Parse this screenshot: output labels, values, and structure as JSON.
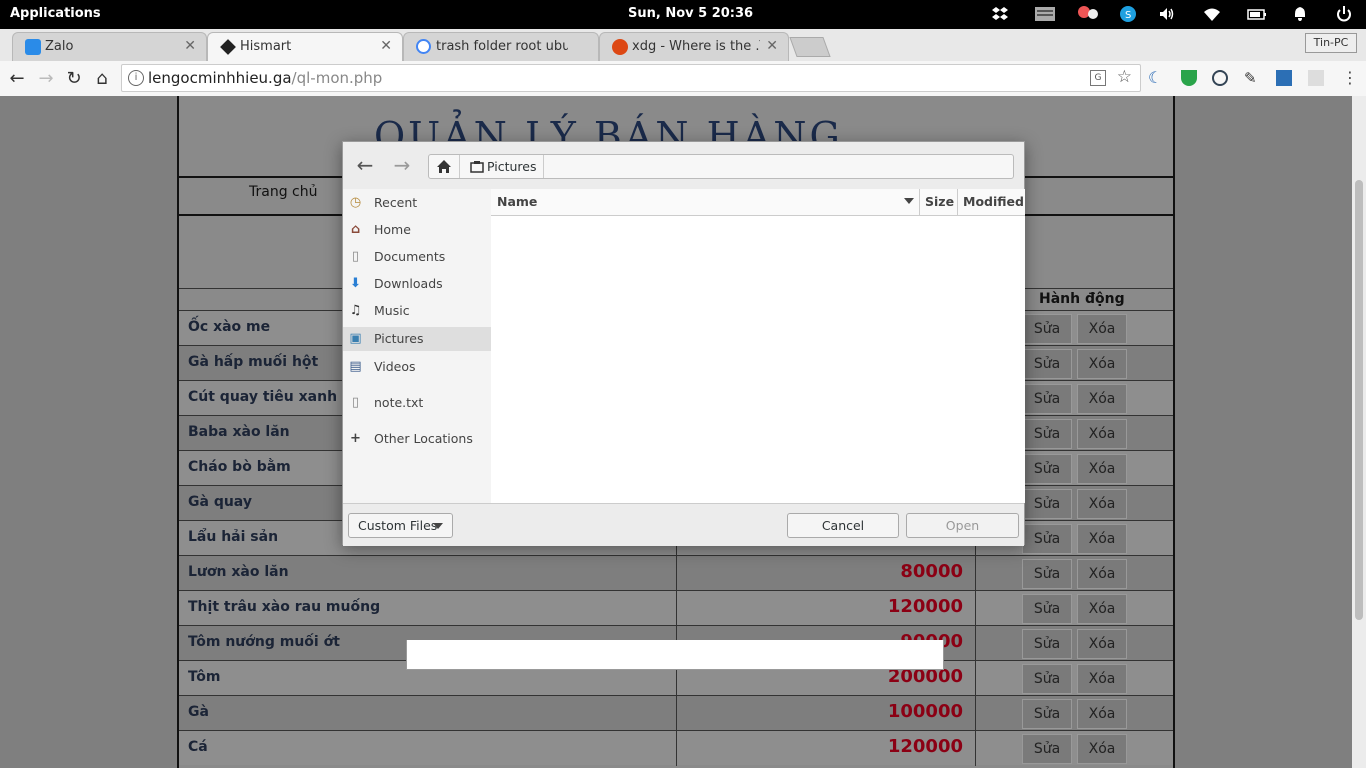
{
  "topbar": {
    "applications": "Applications",
    "clock": "Sun, Nov  5   20:36"
  },
  "tabs": [
    {
      "title": "Zalo",
      "active": false
    },
    {
      "title": "Hismart",
      "active": true
    },
    {
      "title": "trash folder root ubuntu",
      "active": false
    },
    {
      "title": "xdg - Where is the .Tras",
      "active": false
    }
  ],
  "profile": "Tin-PC",
  "address": {
    "host": "lengocminhhieu.ga",
    "path": "/ql-mon.php"
  },
  "site": {
    "banner_title": "QUẢN LÝ BÁN HÀNG",
    "menu_home": "Trang chủ",
    "actions_header": "Hành động",
    "edit_label": "Sửa",
    "delete_label": "Xóa",
    "rows": [
      {
        "name": "Ốc xào me",
        "price": ""
      },
      {
        "name": "Gà hấp muối hột",
        "price": ""
      },
      {
        "name": "Cút quay tiêu xanh",
        "price": ""
      },
      {
        "name": "Baba xào lăn",
        "price": ""
      },
      {
        "name": "Cháo bò bằm",
        "price": ""
      },
      {
        "name": "Gà quay",
        "price": ""
      },
      {
        "name": "Lẩu hải sản",
        "price": ""
      },
      {
        "name": "Lươn xào lăn",
        "price": "80000"
      },
      {
        "name": "Thịt trâu xào rau muống",
        "price": "120000"
      },
      {
        "name": "Tôm nướng muối ớt",
        "price": "90000"
      },
      {
        "name": "Tôm",
        "price": "200000"
      },
      {
        "name": "Gà",
        "price": "100000"
      },
      {
        "name": "Cá",
        "price": "120000"
      }
    ]
  },
  "dialog": {
    "current_folder": "Pictures",
    "places": [
      {
        "label": "Recent",
        "icon": "clock-icon"
      },
      {
        "label": "Home",
        "icon": "home-icon"
      },
      {
        "label": "Documents",
        "icon": "document-icon"
      },
      {
        "label": "Downloads",
        "icon": "download-icon"
      },
      {
        "label": "Music",
        "icon": "music-icon"
      },
      {
        "label": "Pictures",
        "icon": "pictures-icon",
        "selected": true
      },
      {
        "label": "Videos",
        "icon": "video-icon"
      },
      {
        "label": "note.txt",
        "icon": "file-icon"
      },
      {
        "label": "Other Locations",
        "icon": "plus-icon"
      }
    ],
    "columns": {
      "name": "Name",
      "size": "Size",
      "modified": "Modified"
    },
    "filter": "Custom Files",
    "cancel": "Cancel",
    "open": "Open"
  }
}
